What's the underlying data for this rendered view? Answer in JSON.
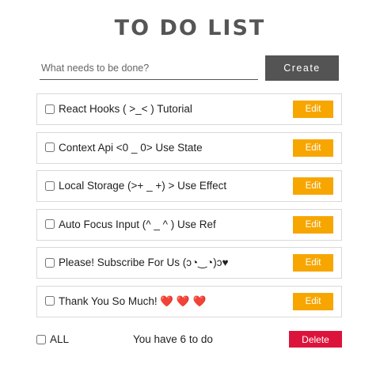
{
  "app": {
    "title": "TO DO LIST"
  },
  "create": {
    "placeholder": "What needs to be done?",
    "value": "",
    "button_label": "Create"
  },
  "todos": [
    {
      "text": "React Hooks ( >_< ) Tutorial",
      "checked": false,
      "edit_label": "Edit"
    },
    {
      "text": "Context Api <0 _ 0> Use State",
      "checked": false,
      "edit_label": "Edit"
    },
    {
      "text": "Local Storage (>+ _ +) > Use Effect",
      "checked": false,
      "edit_label": "Edit"
    },
    {
      "text": "Auto Focus Input (^ _ ^ ) Use Ref",
      "checked": false,
      "edit_label": "Edit"
    },
    {
      "text": "Please! Subscribe For Us (ↄ◔‿◔)ↄ♥",
      "checked": false,
      "edit_label": "Edit"
    },
    {
      "text": "Thank You So Much! ❤️ ❤️ ❤️",
      "checked": false,
      "edit_label": "Edit"
    }
  ],
  "footer": {
    "all_label": "ALL",
    "all_checked": false,
    "remaining_text": "You have 6 to do",
    "delete_label": "Delete"
  },
  "colors": {
    "create_button": "#545454",
    "edit_button": "#f7a600",
    "delete_button": "#dc143c",
    "title": "#555555"
  },
  "icons": {
    "todo_checkbox": "checkbox-icon",
    "heart": "heart-icon"
  }
}
